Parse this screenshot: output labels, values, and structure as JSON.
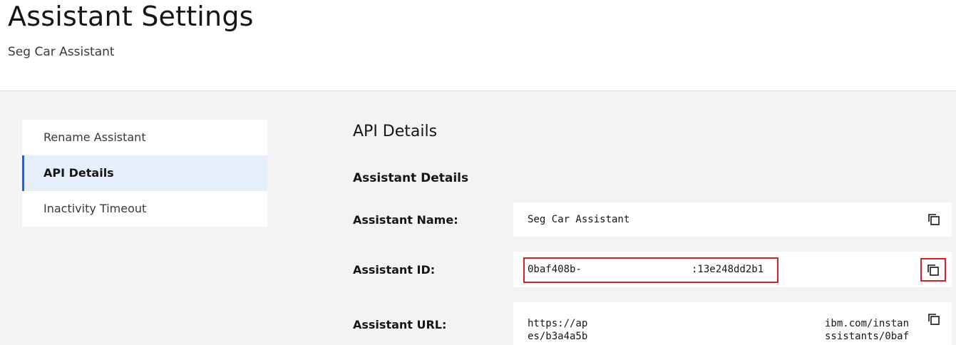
{
  "header": {
    "title": "Assistant Settings",
    "subtitle": "Seg Car Assistant"
  },
  "nav": {
    "items": [
      {
        "label": "Rename Assistant",
        "active": false
      },
      {
        "label": "API Details",
        "active": true
      },
      {
        "label": "Inactivity Timeout",
        "active": false
      }
    ]
  },
  "main": {
    "section_title": "API Details",
    "subsection_title": "Assistant Details",
    "fields": {
      "name": {
        "label": "Assistant Name:",
        "value": "Seg Car Assistant",
        "copy_icon": "copy-icon"
      },
      "id": {
        "label": "Assistant ID:",
        "value_start": "0baf408b-",
        "value_end": ":13e248dd2b1",
        "copy_icon": "copy-icon"
      },
      "url": {
        "label": "Assistant URL:",
        "line1_start": "https://ap",
        "line1_end": "ibm.com/instan",
        "line2_start": "es/b3a4a5b",
        "line2_end": "ssistants/0baf",
        "copy_icon": "copy-icon"
      }
    }
  },
  "colors": {
    "highlight": "#da1e28",
    "active_nav_bg": "#e5eef9",
    "active_nav_border": "#0f62fe",
    "page_bg": "#f3f3f3"
  }
}
